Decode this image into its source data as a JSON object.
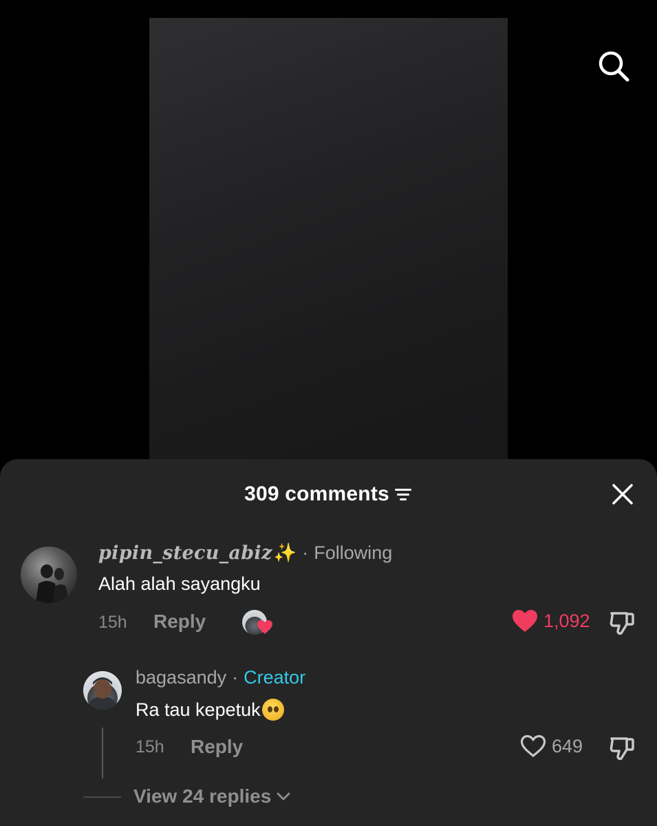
{
  "video": {
    "search_icon": "search-icon"
  },
  "sheet": {
    "comments_count": "309 comments",
    "sort_icon": "filter-lines-icon",
    "close_icon": "close-icon"
  },
  "comments": [
    {
      "username": "pipin_stecu_abiz",
      "username_emoji": "✨",
      "separator": "·",
      "relationship": "Following",
      "text": "Alah alah sayangku",
      "time": "15h",
      "reply_label": "Reply",
      "liked_by_creator": true,
      "likes": "1,092",
      "liked": true
    }
  ],
  "replies": [
    {
      "username": "bagasandy",
      "separator": "·",
      "badge": "Creator",
      "text": "Ra tau kepetuk",
      "emoji": "pleading-face-emoji",
      "time": "15h",
      "reply_label": "Reply",
      "likes": "649",
      "liked": false
    }
  ],
  "view_replies_label": "View 24 replies",
  "colors": {
    "sheet_bg": "#252525",
    "liked_red": "#f03c5f",
    "creator_blue": "#35c8e8",
    "muted": "#8f8f8f"
  }
}
